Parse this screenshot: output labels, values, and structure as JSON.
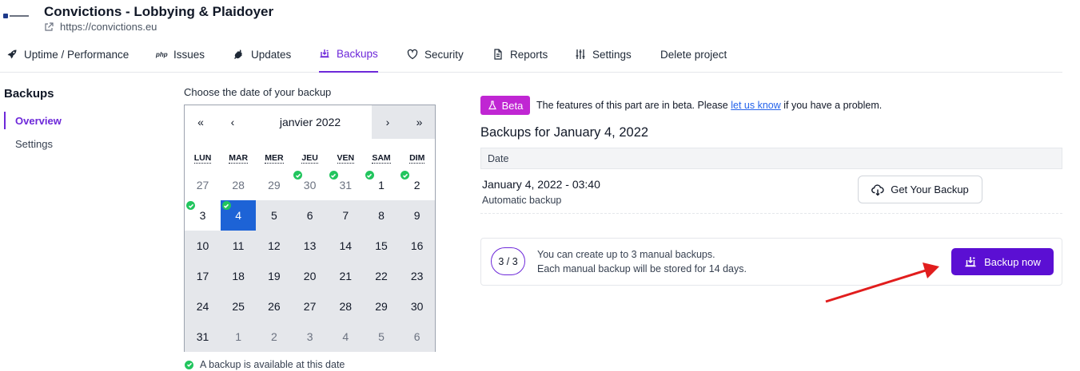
{
  "project": {
    "title": "Convictions - Lobbying & Plaidoyer",
    "url": "https://convictions.eu"
  },
  "tabs": [
    {
      "label": "Uptime / Performance",
      "icon": "rocket-icon"
    },
    {
      "label": "Issues",
      "icon": "php-icon"
    },
    {
      "label": "Updates",
      "icon": "plug-icon"
    },
    {
      "label": "Backups",
      "icon": "backup-icon",
      "active": true
    },
    {
      "label": "Security",
      "icon": "shield-icon"
    },
    {
      "label": "Reports",
      "icon": "document-icon"
    },
    {
      "label": "Settings",
      "icon": "sliders-icon"
    },
    {
      "label": "Delete project"
    }
  ],
  "sidebar": {
    "title": "Backups",
    "items": [
      {
        "label": "Overview",
        "active": true
      },
      {
        "label": "Settings"
      }
    ]
  },
  "calendar": {
    "label": "Choose the date of your backup",
    "nav": {
      "first": "«",
      "prev": "‹",
      "next": "›",
      "last": "»"
    },
    "month": "janvier 2022",
    "weekdays": [
      "LUN",
      "MAR",
      "MER",
      "JEU",
      "VEN",
      "SAM",
      "DIM"
    ],
    "days": [
      {
        "d": "27",
        "other": true
      },
      {
        "d": "28",
        "other": true
      },
      {
        "d": "29",
        "other": true
      },
      {
        "d": "30",
        "other": true,
        "backup": true
      },
      {
        "d": "31",
        "other": true,
        "backup": true
      },
      {
        "d": "1",
        "backup": true
      },
      {
        "d": "2",
        "backup": true
      },
      {
        "d": "3",
        "backup": true
      },
      {
        "d": "4",
        "backup": true,
        "selected": true
      },
      {
        "d": "5"
      },
      {
        "d": "6"
      },
      {
        "d": "7"
      },
      {
        "d": "8"
      },
      {
        "d": "9"
      },
      {
        "d": "10"
      },
      {
        "d": "11"
      },
      {
        "d": "12"
      },
      {
        "d": "13"
      },
      {
        "d": "14"
      },
      {
        "d": "15"
      },
      {
        "d": "16"
      },
      {
        "d": "17"
      },
      {
        "d": "18"
      },
      {
        "d": "19"
      },
      {
        "d": "20"
      },
      {
        "d": "21"
      },
      {
        "d": "22"
      },
      {
        "d": "23"
      },
      {
        "d": "24"
      },
      {
        "d": "25"
      },
      {
        "d": "26"
      },
      {
        "d": "27"
      },
      {
        "d": "28"
      },
      {
        "d": "29"
      },
      {
        "d": "30"
      },
      {
        "d": "31"
      },
      {
        "d": "1",
        "other": true
      },
      {
        "d": "2",
        "other": true
      },
      {
        "d": "3",
        "other": true
      },
      {
        "d": "4",
        "other": true
      },
      {
        "d": "5",
        "other": true
      },
      {
        "d": "6",
        "other": true
      }
    ],
    "legend": "A backup is available at this date"
  },
  "beta": {
    "badge": "Beta",
    "text_before": "The features of this part are in beta. Please",
    "link": "let us know",
    "text_after": "if you have a problem."
  },
  "backups": {
    "title": "Backups for January 4, 2022",
    "column_date": "Date",
    "entry_date": "January 4, 2022 - 03:40",
    "entry_type": "Automatic backup",
    "get_button": "Get Your Backup"
  },
  "manual": {
    "counter": "3 / 3",
    "line1": "You can create up to 3 manual backups.",
    "line2": "Each manual backup will be stored for 14 days.",
    "button": "Backup now"
  },
  "colors": {
    "accent": "#6d28d9",
    "primary_button": "#5b0fd3",
    "beta": "#c026d3",
    "selected_day": "#1d63d6",
    "backup_check": "#22c55e",
    "annotation_arrow": "#e11d1d"
  }
}
